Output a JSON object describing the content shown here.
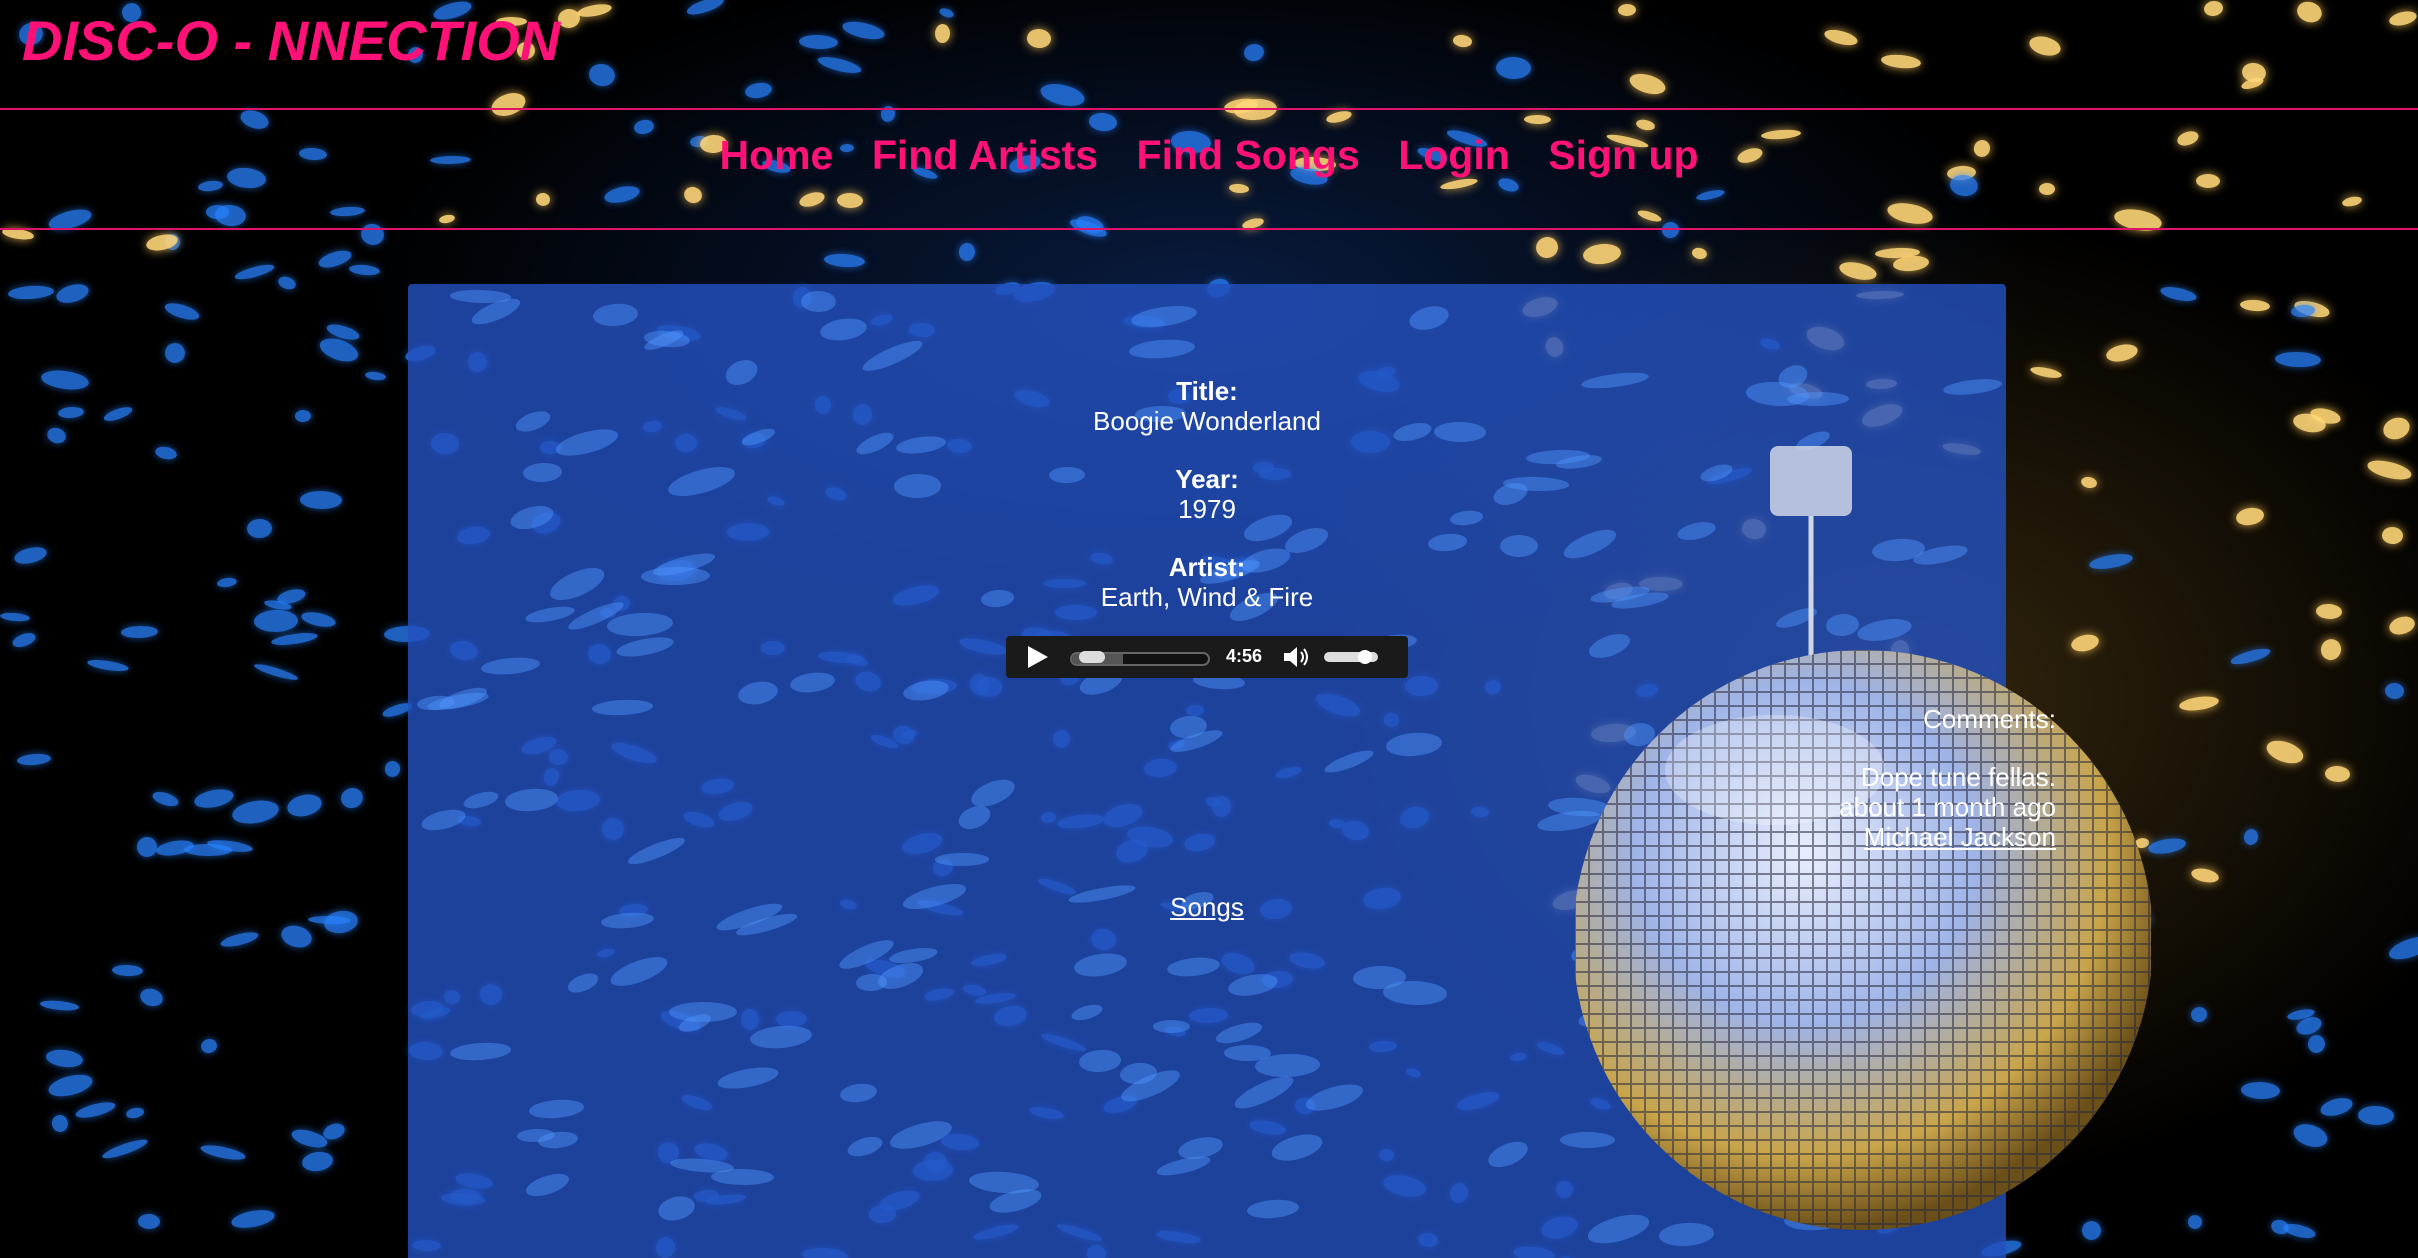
{
  "site": {
    "title": "DISC-O - NNECTION"
  },
  "nav": {
    "items": [
      {
        "label": "Home"
      },
      {
        "label": "Find Artists"
      },
      {
        "label": "Find Songs"
      },
      {
        "label": "Login"
      },
      {
        "label": "Sign up"
      }
    ]
  },
  "song": {
    "title_label": "Title:",
    "title": "Boogie Wonderland",
    "year_label": "Year:",
    "year": "1979",
    "artist_label": "Artist:",
    "artist": "Earth, Wind & Fire"
  },
  "player": {
    "duration": "4:56",
    "progress_fraction": 0.08,
    "volume_fraction": 0.85
  },
  "comments": {
    "heading": "Comments:",
    "items": [
      {
        "text": "Dope tune fellas.",
        "time": "about 1 month ago",
        "author": "Michael Jackson"
      }
    ]
  },
  "links": {
    "songs": "Songs"
  },
  "colors": {
    "accent": "#ff1177",
    "panel": "#2350be",
    "background": "#000000"
  }
}
